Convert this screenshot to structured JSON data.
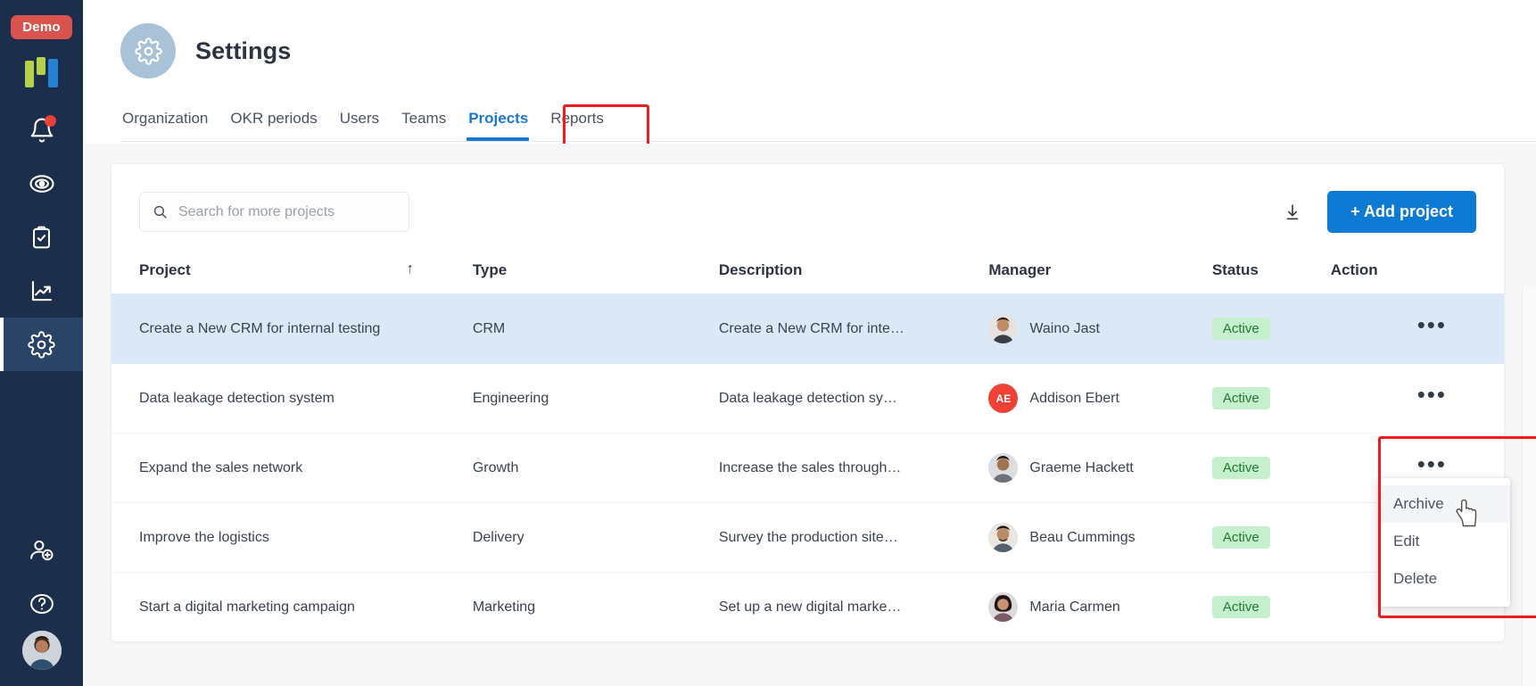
{
  "sidebar": {
    "demo_badge": "Demo",
    "logo": "logo-mark",
    "items": [
      {
        "icon": "notifications-bell-icon",
        "label": "Notifications",
        "has_dot": true
      },
      {
        "icon": "objectives-target-icon",
        "label": "Objectives",
        "has_dot": false
      },
      {
        "icon": "tasks-clipboard-check-icon",
        "label": "Tasks",
        "has_dot": false
      },
      {
        "icon": "analytics-trend-chart-icon",
        "label": "Analytics",
        "has_dot": false
      },
      {
        "icon": "settings-gear-icon",
        "label": "Settings",
        "has_dot": false,
        "active": true
      }
    ],
    "bottom_items": [
      {
        "icon": "invite-user-add-icon",
        "label": "Invite user"
      },
      {
        "icon": "help-question-circle-icon",
        "label": "Help"
      },
      {
        "icon": "user-avatar",
        "label": "Account"
      }
    ]
  },
  "header": {
    "title": "Settings",
    "icon": "settings-gear-icon"
  },
  "tabs": [
    {
      "label": "Organization",
      "active": false
    },
    {
      "label": "OKR periods",
      "active": false
    },
    {
      "label": "Users",
      "active": false
    },
    {
      "label": "Teams",
      "active": false
    },
    {
      "label": "Projects",
      "active": true
    },
    {
      "label": "Reports",
      "active": false
    }
  ],
  "toolbar": {
    "search_placeholder": "Search for more projects",
    "search_value": "",
    "search_icon": "search-icon",
    "download_icon": "download-icon",
    "add_button_label": "+ Add project"
  },
  "table": {
    "columns": [
      {
        "key": "project",
        "label": "Project",
        "sort": "asc",
        "sort_glyph": "↑"
      },
      {
        "key": "type",
        "label": "Type"
      },
      {
        "key": "description",
        "label": "Description"
      },
      {
        "key": "manager",
        "label": "Manager"
      },
      {
        "key": "status",
        "label": "Status"
      },
      {
        "key": "action",
        "label": "Action"
      }
    ],
    "rows": [
      {
        "project": "Create a New CRM for internal testing",
        "type": "CRM",
        "description": "Create a New CRM for inte…",
        "manager": "Waino Jast",
        "manager_avatar_type": "photo",
        "manager_initials": "",
        "status": "Active",
        "action_glyph": "•••",
        "selected": true
      },
      {
        "project": "Data leakage detection system",
        "type": "Engineering",
        "description": "Data leakage detection sy…",
        "manager": "Addison Ebert",
        "manager_avatar_type": "initials",
        "manager_initials": "AE",
        "status": "Active",
        "action_glyph": "•••",
        "selected": false
      },
      {
        "project": "Expand the sales network",
        "type": "Growth",
        "description": "Increase the sales through…",
        "manager": "Graeme Hackett",
        "manager_avatar_type": "photo",
        "manager_initials": "",
        "status": "Active",
        "action_glyph": "•••",
        "selected": false
      },
      {
        "project": "Improve the logistics",
        "type": "Delivery",
        "description": "Survey the production site…",
        "manager": "Beau Cummings",
        "manager_avatar_type": "photo",
        "manager_initials": "",
        "status": "Active",
        "action_glyph": "•••",
        "selected": false
      },
      {
        "project": "Start a digital marketing campaign",
        "type": "Marketing",
        "description": "Set up a new digital marke…",
        "manager": "Maria Carmen",
        "manager_avatar_type": "photo",
        "manager_initials": "",
        "status": "Active",
        "action_glyph": "•••",
        "selected": false
      }
    ]
  },
  "context_menu": {
    "open": true,
    "items": [
      {
        "label": "Archive",
        "hovered": true
      },
      {
        "label": "Edit",
        "hovered": false
      },
      {
        "label": "Delete",
        "hovered": false
      }
    ]
  },
  "colors": {
    "sidebar_bg": "#1b2e4b",
    "sidebar_active": "#2a4468",
    "accent_blue": "#0d7bd4",
    "tab_active": "#1b78d0",
    "demo_badge": "#d9534f",
    "row_selected": "#dbe8f7",
    "status_bg": "#c6efcd",
    "status_text": "#1f7a32",
    "highlight_outline": "#ee1c1c",
    "page_bg": "#f7f7f8",
    "notification_dot": "#e8413a"
  }
}
